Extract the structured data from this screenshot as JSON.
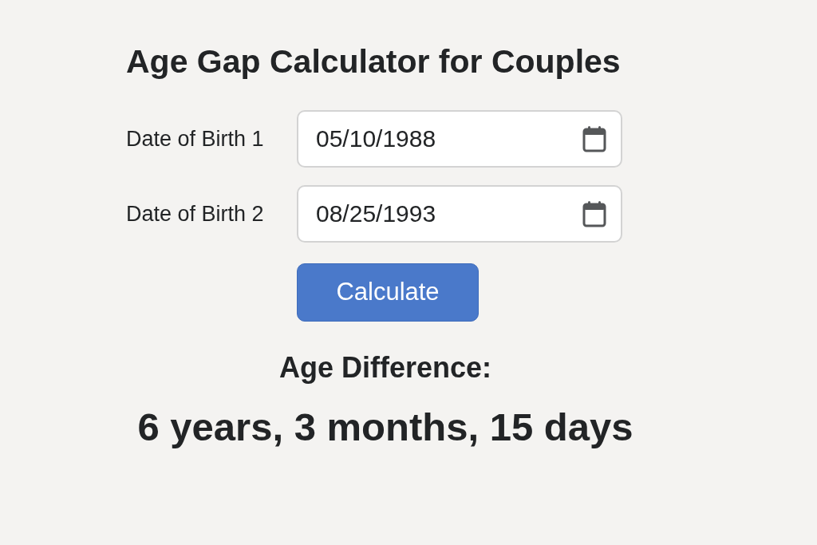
{
  "title": "Age Gap Calculator for Couples",
  "fields": [
    {
      "label": "Date of Birth 1",
      "value": "05/10/1988"
    },
    {
      "label": "Date of Birth 2",
      "value": "08/25/1993"
    }
  ],
  "button": {
    "label": "Calculate"
  },
  "result": {
    "heading": "Age Difference:",
    "value": "6 years, 3 months, 15 days"
  }
}
